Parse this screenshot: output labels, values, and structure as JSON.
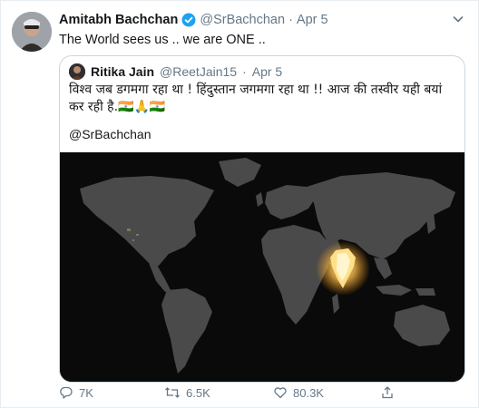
{
  "author": {
    "name": "Amitabh Bachchan",
    "handle": "@SrBachchan",
    "separator": "·",
    "date": "Apr 5",
    "text": "The World sees us .. we are ONE .."
  },
  "quoted": {
    "name": "Ritika Jain",
    "handle": "@ReetJain15",
    "separator": "·",
    "date": "Apr 5",
    "text": "विश्व जब डगमगा रहा था ! हिंदुस्तान जगमगा रहा था !! आज की तस्वीर यही बयां कर रही है.🇮🇳🙏🇮🇳",
    "mention": "@SrBachchan"
  },
  "actions": {
    "reply_count": "7K",
    "retweet_count": "6.5K",
    "like_count": "80.3K"
  },
  "colors": {
    "verified": "#1da1f2",
    "secondary_text": "#657786",
    "border": "#ccd6dd",
    "map_land": "#4a4a4a",
    "india_glow": "#ffd27a"
  },
  "icons": [
    "verified-icon",
    "caret-down-icon",
    "reply-icon",
    "retweet-icon",
    "like-icon",
    "share-icon"
  ]
}
